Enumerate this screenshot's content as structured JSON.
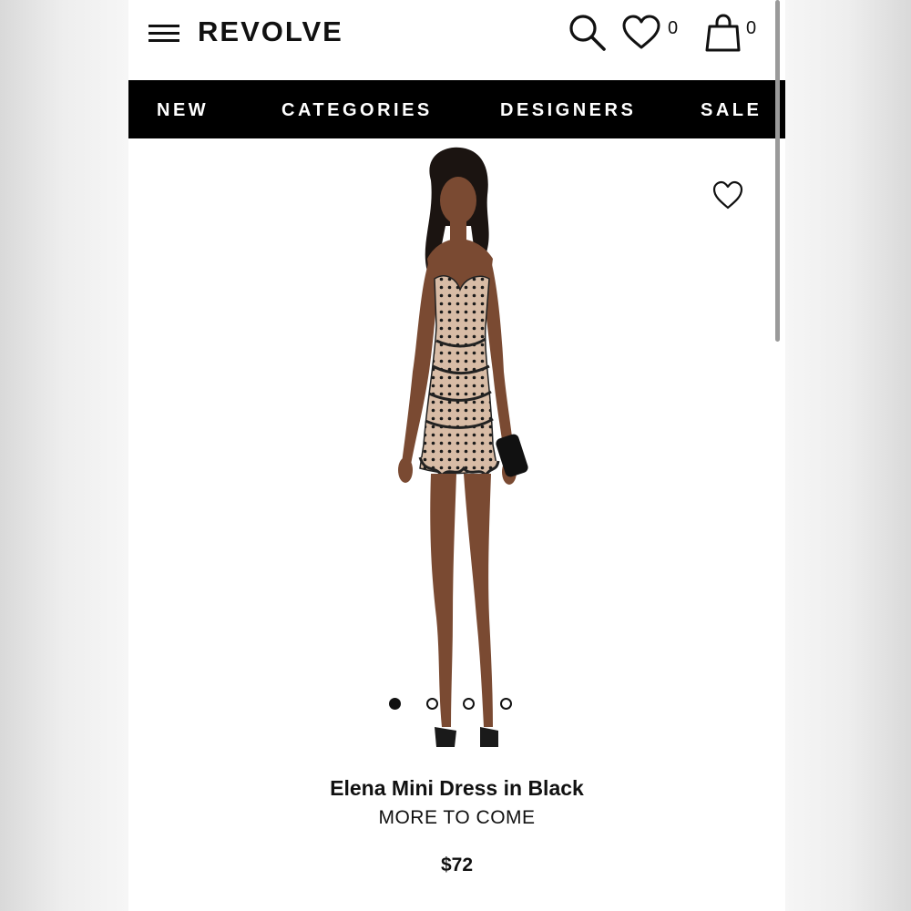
{
  "header": {
    "logo": "REVOLVE",
    "wishlist_count": "0",
    "bag_count": "0"
  },
  "nav": {
    "items": [
      "NEW",
      "CATEGORIES",
      "DESIGNERS",
      "SALE"
    ]
  },
  "carousel": {
    "total_images": 4,
    "active_index": 0
  },
  "product": {
    "name": "Elena Mini Dress in Black",
    "brand": "MORE TO COME",
    "price": "$72"
  },
  "icons": {
    "menu": "hamburger-icon",
    "search": "search-icon",
    "wishlist": "heart-icon",
    "bag": "shopping-bag-icon"
  },
  "colors": {
    "nav_background": "#000000",
    "nav_text": "#ffffff",
    "text": "#111111",
    "page_background": "#ffffff"
  }
}
